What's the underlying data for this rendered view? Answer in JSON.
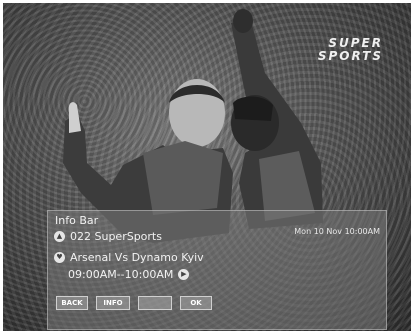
{
  "channel_logo": {
    "line1": "SUPER",
    "line2": "SPORTS"
  },
  "info_bar": {
    "title": "Info Bar",
    "datetime": "Mon 10 Nov  10:00AM",
    "channel": "022 SuperSports",
    "program": "Arsenal Vs Dynamo Kyiv",
    "time_range": "09:00AM--10:00AM",
    "buttons": {
      "back": "BACK",
      "info": "INFO",
      "blank": "",
      "ok": "OK"
    },
    "icons": {
      "channel": "up-arrow-icon",
      "program": "heart-icon",
      "time": "right-arrow-icon"
    }
  }
}
